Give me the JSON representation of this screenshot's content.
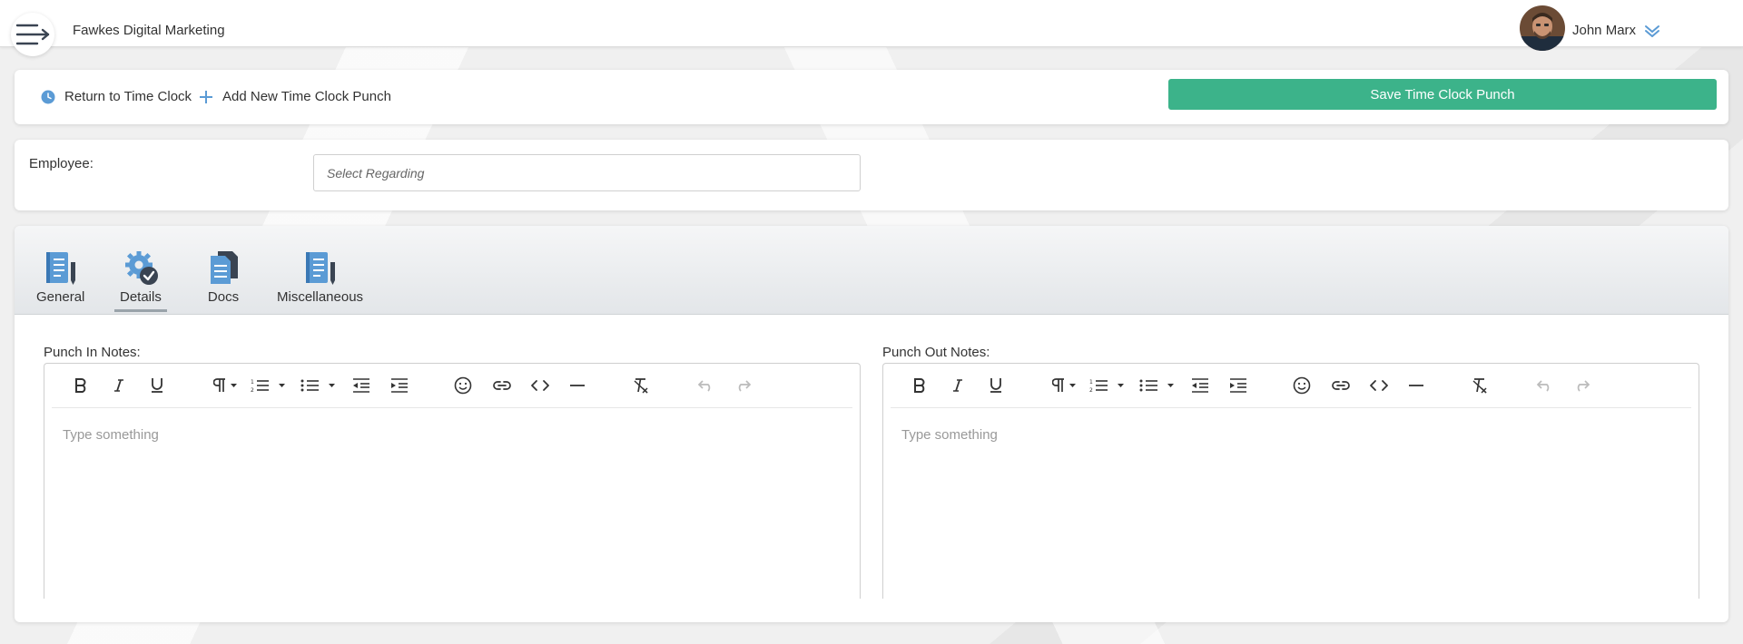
{
  "header": {
    "company": "Fawkes Digital Marketing",
    "user_name": "John Marx"
  },
  "actions": {
    "return_label": "Return to Time Clock",
    "add_label": "Add New Time Clock Punch",
    "save_label": "Save Time Clock Punch"
  },
  "employee": {
    "label": "Employee:",
    "placeholder": "Select Regarding"
  },
  "tabs": [
    {
      "label": "General",
      "icon": "notebook-icon"
    },
    {
      "label": "Details",
      "icon": "gear-check-icon"
    },
    {
      "label": "Docs",
      "icon": "documents-icon"
    },
    {
      "label": "Miscellaneous",
      "icon": "notebook-icon"
    }
  ],
  "editors": {
    "punch_in": {
      "label": "Punch In Notes:",
      "placeholder": "Type something"
    },
    "punch_out": {
      "label": "Punch Out Notes:",
      "placeholder": "Type something"
    }
  },
  "toolbar_icons": [
    "bold-icon",
    "italic-icon",
    "underline-icon",
    "paragraph-icon",
    "ordered-list-icon",
    "unordered-list-icon",
    "outdent-icon",
    "indent-icon",
    "emoji-icon",
    "link-icon",
    "code-icon",
    "horizontal-rule-icon",
    "clear-format-icon",
    "undo-icon",
    "redo-icon"
  ],
  "colors": {
    "primary_button": "#3cb38a",
    "icon_blue": "#5b9bd5",
    "icon_dark": "#3a4452"
  }
}
